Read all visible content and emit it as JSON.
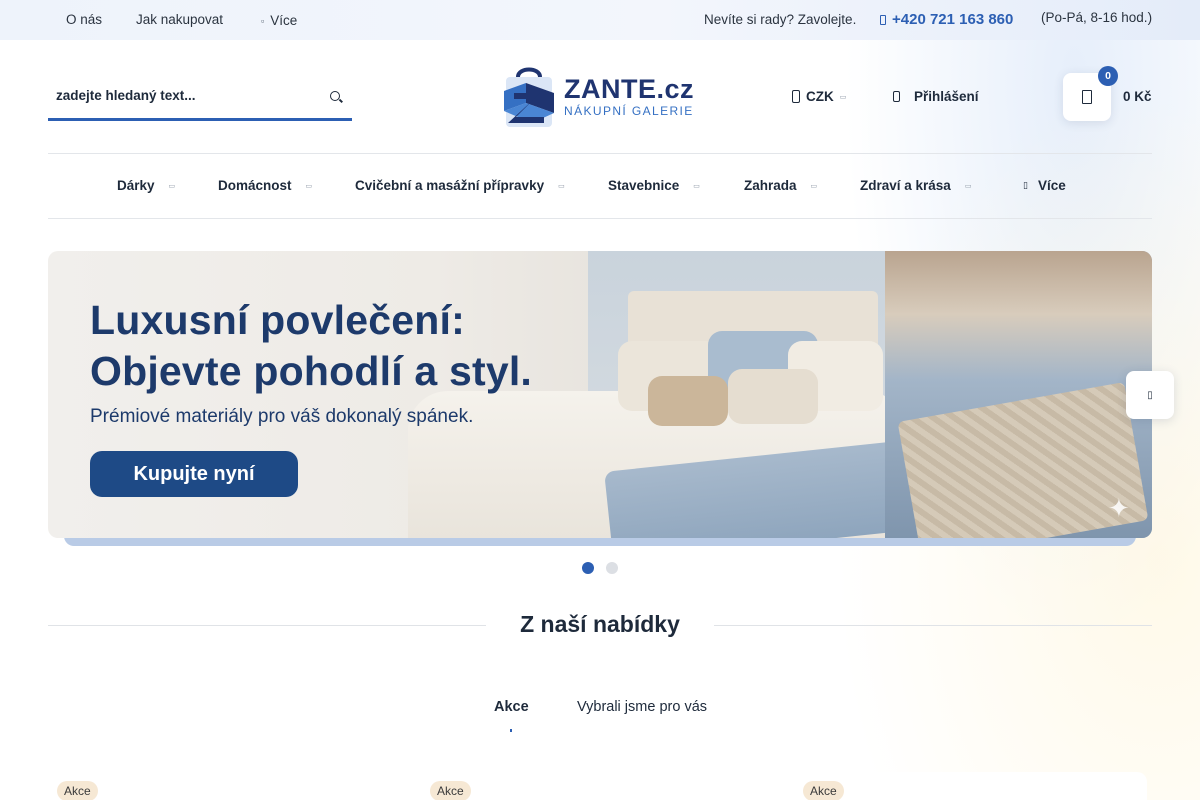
{
  "topbar": {
    "links": [
      "O nás",
      "Jak nakupovat"
    ],
    "more_label": "Více",
    "help_text": "Nevíte si rady? Zavolejte.",
    "phone": "+420 721 163 860",
    "hours": "(Po-Pá, 8-16 hod.)"
  },
  "header": {
    "search_placeholder": "zadejte hledaný text...",
    "logo": {
      "name": "ZANTE.cz",
      "tagline": "NÁKUPNÍ GALERIE"
    },
    "currency": "CZK",
    "login_label": "Přihlášení",
    "cart": {
      "count": "0",
      "total": "0 Kč"
    }
  },
  "nav": {
    "items": [
      "Dárky",
      "Domácnost",
      "Cvičební a masážní přípravky",
      "Stavebnice",
      "Zahrada",
      "Zdraví a krása"
    ],
    "more_label": "Více"
  },
  "banner": {
    "title_line1": "Luxusní povlečení:",
    "title_line2": "Objevte pohodlí a styl.",
    "subtitle": "Prémiové materiály pro váš dokonalý spánek.",
    "cta": "Kupujte nyní"
  },
  "slider": {
    "active_index": 1,
    "total": 2
  },
  "offers": {
    "title": "Z naší nabídky",
    "tabs": [
      "Akce",
      "Vybrali jsme pro vás"
    ],
    "active_tab": "Akce",
    "badges": [
      "Akce",
      "Akce",
      "Akce"
    ]
  },
  "colors": {
    "accent": "#2c5fb3",
    "text": "#1e2a3b",
    "banner_cta": "#1e4a86",
    "badge_bg": "#f6e8d4"
  }
}
